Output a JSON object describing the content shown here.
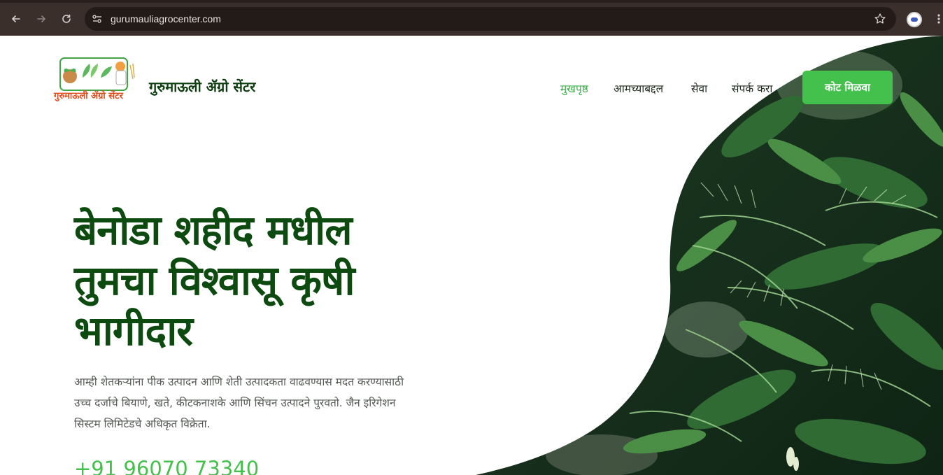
{
  "browser": {
    "url": "gurumauliagrocenter.com",
    "back_icon": "arrow-left-icon",
    "forward_icon": "arrow-right-icon",
    "reload_icon": "reload-icon",
    "site_settings_icon": "tune-icon",
    "bookmark_icon": "star-icon",
    "menu_icon": "kebab-menu-icon"
  },
  "header": {
    "logo_text": "गुरुमाऊली ॲग्रो सेंटर",
    "brand_name": "गुरुमाऊली ॲग्रो सेंटर",
    "nav": [
      {
        "label": "मुखपृष्ठ",
        "active": true
      },
      {
        "label": "आमच्याबद्दल",
        "active": false
      },
      {
        "label": "सेवा",
        "active": false
      },
      {
        "label": "संपर्क करा",
        "active": false
      }
    ],
    "cta_label": "कोट मिळवा"
  },
  "hero": {
    "headline_lines": [
      "बेनोडा शहीद मधील",
      "तुमचा विश्वासू कृषी",
      "भागीदार"
    ],
    "description_lines": [
      "आम्ही शेतकऱ्यांना पीक उत्पादन आणि शेती उत्पादकता वाढवण्यास मदत करण्यासाठी",
      "उच्च दर्जाचे बियाणे, खते, कीटकनाशके आणि सिंचन उत्पादने पुरवतो. जैन इरिगेशन",
      "सिस्टम लिमिटेडचे अधिकृत विक्रेता."
    ],
    "phone": "+91 96070 73340"
  },
  "colors": {
    "brand_dark_green": "#0d4a10",
    "accent_green": "#44c04d",
    "nav_active": "#3fae4a",
    "chrome_bg": "#3a2f2b"
  }
}
